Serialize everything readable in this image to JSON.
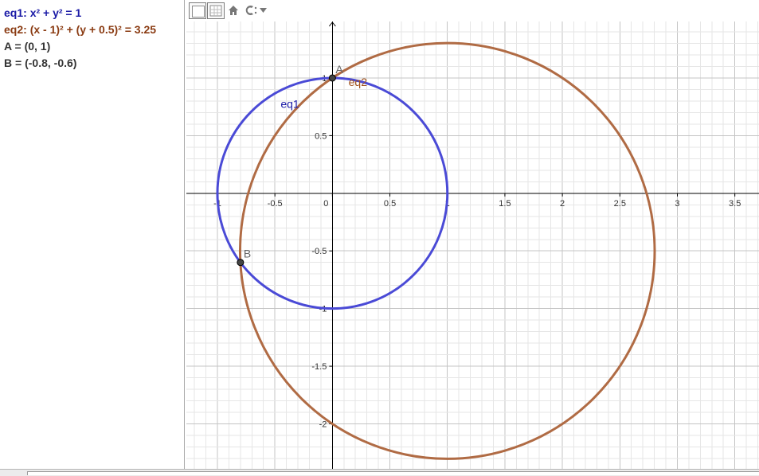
{
  "algebra": {
    "items": [
      {
        "name": "eq1",
        "expr": "x² + y² = 1",
        "color": "#1a1aa6"
      },
      {
        "name": "eq2",
        "expr": "(x - 1)² + (y + 0.5)² = 3.25",
        "color": "#8a3b12"
      },
      {
        "name": "A",
        "expr": "(0, 1)",
        "color": "#333333"
      },
      {
        "name": "B",
        "expr": "(-0.8, -0.6)",
        "color": "#333333"
      }
    ]
  },
  "toolbar": {
    "icons": [
      "algebra-view-toggle-icon",
      "graphics-view-toggle-icon",
      "home-icon",
      "style-menu-icon",
      "chevron-down-icon"
    ]
  },
  "chart_data": {
    "type": "scatter",
    "xlim": [
      -1.27,
      3.71
    ],
    "ylim": [
      -2.39,
      1.49
    ],
    "grid": true,
    "x_ticks": [
      -1,
      -0.5,
      0,
      0.5,
      1,
      1.5,
      2,
      2.5,
      3,
      3.5
    ],
    "x_tick_labels": [
      "-1",
      "-0.5",
      "0",
      "0.5",
      "1",
      "1.5",
      "2",
      "2.5",
      "3",
      "3.5"
    ],
    "y_ticks": [
      1,
      0.5,
      -0.5,
      -1,
      -1.5,
      -2
    ],
    "y_tick_labels": [
      "1",
      "0.5",
      "-0.5",
      "-1",
      "-1.5",
      "-2"
    ],
    "circles": [
      {
        "name": "eq1",
        "label": "eq1",
        "cx": 0,
        "cy": 0,
        "r": 1,
        "color": "#4a4ad6"
      },
      {
        "name": "eq2",
        "label": "eq2",
        "cx": 1,
        "cy": -0.5,
        "r": 1.8028,
        "color": "#b06b44"
      }
    ],
    "points": [
      {
        "name": "A",
        "label": "A",
        "x": 0,
        "y": 1
      },
      {
        "name": "B",
        "label": "B",
        "x": -0.8,
        "y": -0.6
      }
    ],
    "colors": {
      "grid_minor": "#e6e6e6",
      "grid_major": "#c4c4c4",
      "axis": "#000000",
      "tick_label": "#333333",
      "eq1_label": "#1a1aa6",
      "eq2_label": "#a0521e",
      "point_fill": "#444444",
      "point_label": "#666666"
    }
  }
}
